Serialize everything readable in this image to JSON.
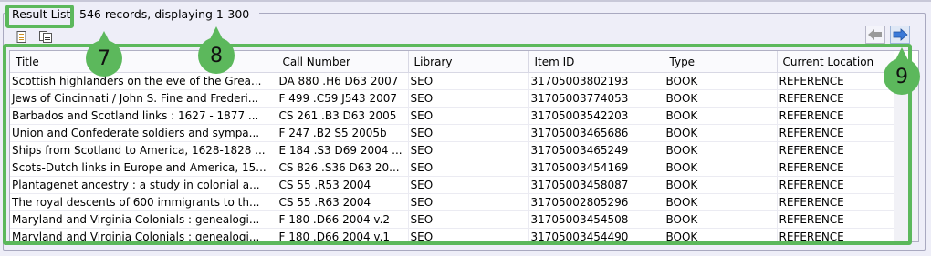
{
  "result_list": {
    "title": "Result List",
    "count_text": "546 records, displaying 1-300"
  },
  "toolbar": {
    "icons": [
      "page-icon",
      "copy-list-icon"
    ],
    "prev_icon": "left-arrow-icon",
    "next_icon": "right-arrow-icon"
  },
  "grid": {
    "columns": [
      "Title",
      "Call Number",
      "Library",
      "Item ID",
      "Type",
      "Current Location"
    ],
    "rows": [
      [
        "Scottish highlanders on the eve of the Grea...",
        "DA 880 .H6 D63 2007",
        "SEO",
        "31705003802193",
        "BOOK",
        "REFERENCE"
      ],
      [
        "Jews of Cincinnati / John S. Fine and Frederi...",
        "F 499 .C59 J543 2007",
        "SEO",
        "31705003774053",
        "BOOK",
        "REFERENCE"
      ],
      [
        "Barbados and Scotland links : 1627 - 1877 ...",
        "CS 261 .B3 D63 2005",
        "SEO",
        "31705003542203",
        "BOOK",
        "REFERENCE"
      ],
      [
        "Union and Confederate soldiers and sympa...",
        "F 247 .B2 S5 2005b",
        "SEO",
        "31705003465686",
        "BOOK",
        "REFERENCE"
      ],
      [
        "Ships from Scotland to America, 1628-1828 ...",
        "E 184 .S3 D69 2004 ...",
        "SEO",
        "31705003465249",
        "BOOK",
        "REFERENCE"
      ],
      [
        "Scots-Dutch links in Europe and America, 15...",
        "CS 826 .S36 D63 20...",
        "SEO",
        "31705003454169",
        "BOOK",
        "REFERENCE"
      ],
      [
        "Plantagenet ancestry : a study in colonial a...",
        "CS 55 .R53 2004",
        "SEO",
        "31705003458087",
        "BOOK",
        "REFERENCE"
      ],
      [
        "The royal descents of 600 immigrants to th...",
        "CS 55 .R63 2004",
        "SEO",
        "31705002805296",
        "BOOK",
        "REFERENCE"
      ],
      [
        "Maryland and Virginia Colonials : genealogi...",
        "F 180 .D66 2004 v.2",
        "SEO",
        "31705003454508",
        "BOOK",
        "REFERENCE"
      ],
      [
        "Maryland and Virginia Colonials : genealogi...",
        "F 180 .D66 2004 v.1",
        "SEO",
        "31705003454490",
        "BOOK",
        "REFERENCE"
      ]
    ]
  },
  "callouts": [
    "7",
    "8",
    "9"
  ],
  "colors": {
    "highlight": "#5cb85c"
  }
}
